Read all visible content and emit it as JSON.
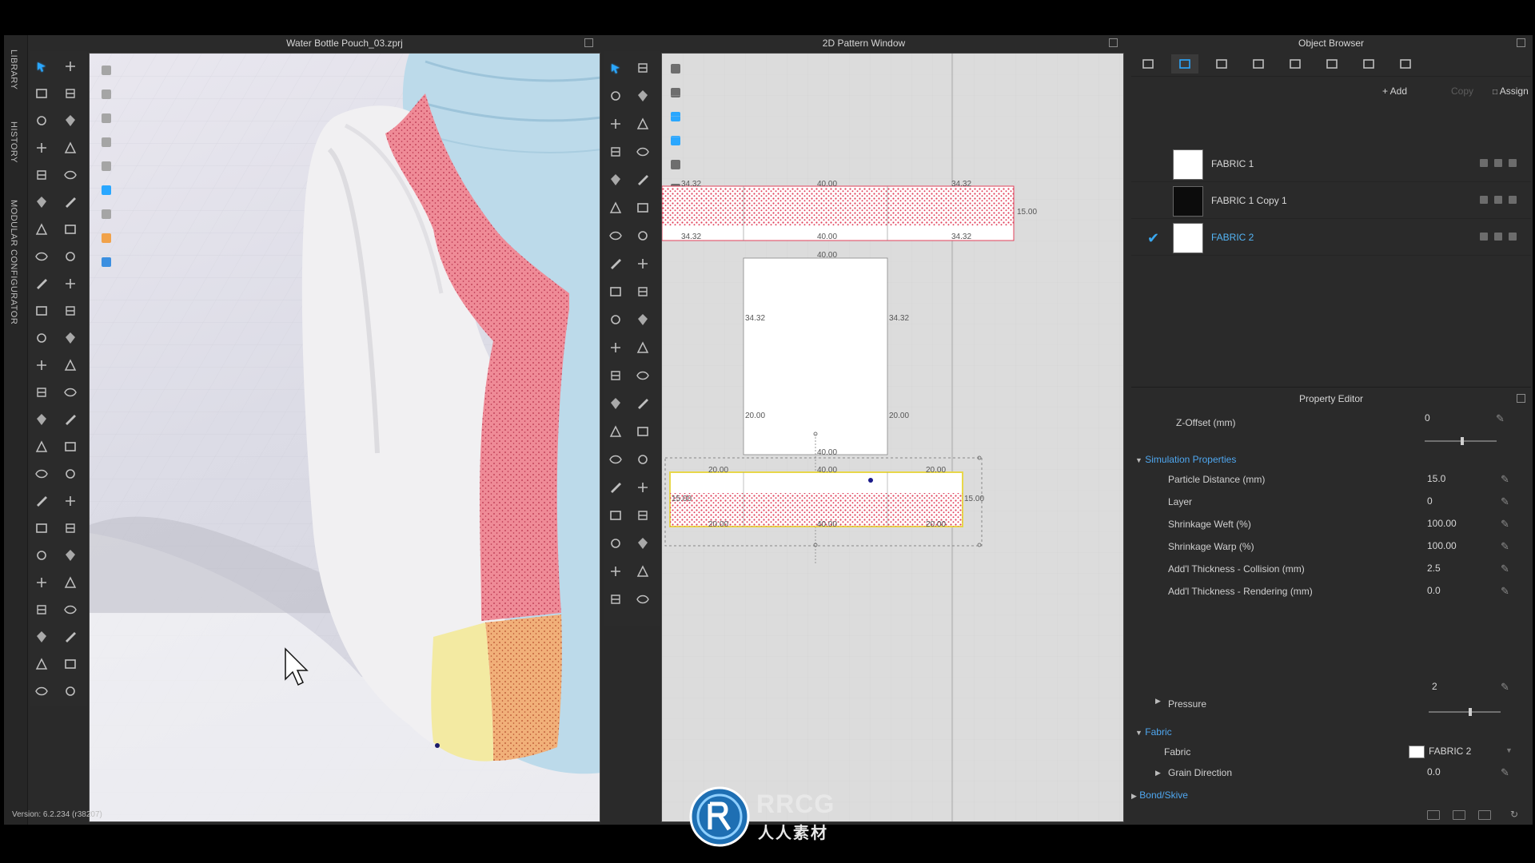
{
  "left_tabs": [
    "LIBRARY",
    "HISTORY",
    "MODULAR CONFIGURATOR"
  ],
  "window_3d": {
    "title": "Water Bottle Pouch_03.zprj"
  },
  "window_2d": {
    "title": "2D Pattern Window",
    "labels": {
      "top_strip_upper": [
        "34.32",
        "40.00",
        "34.32"
      ],
      "top_strip_lower": [
        "34.32",
        "40.00",
        "34.32"
      ],
      "top_strip_side": "15.00",
      "rect_top": "40.00",
      "rect_left_upper": "34.32",
      "rect_right_upper": "34.32",
      "rect_left_lower": "20.00",
      "rect_right_lower": "20.00",
      "rect_bottom": "40.00",
      "bottom_strip_top": [
        "20.00",
        "40.00",
        "20.00"
      ],
      "bottom_strip_bottom": [
        "20.00",
        "40.00",
        "20.00"
      ],
      "bottom_strip_left": "15.00",
      "bottom_strip_right": "15.00"
    }
  },
  "object_browser": {
    "title": "Object Browser",
    "tabs": [
      "list-icon",
      "fabric-icon",
      "button-icon",
      "topstitch-icon",
      "trim-icon",
      "zipper-icon",
      "graphic-icon",
      "tape-icon"
    ],
    "actions": {
      "add": "+ Add",
      "copy": "Copy",
      "assign": "Assign"
    },
    "fabrics": [
      {
        "name": "FABRIC 1",
        "swatch": "#ffffff",
        "selected": false
      },
      {
        "name": "FABRIC 1 Copy 1",
        "swatch": "#0c0c0c",
        "selected": false
      },
      {
        "name": "FABRIC 2",
        "swatch": "#ffffff",
        "selected": true
      }
    ]
  },
  "property_editor": {
    "title": "Property Editor",
    "z_offset": {
      "label": "Z-Offset (mm)",
      "value": "0",
      "slider": 0.5
    },
    "simulation_section": "Simulation Properties",
    "simulation": [
      {
        "label": "Particle Distance (mm)",
        "value": "15.0"
      },
      {
        "label": "Layer",
        "value": "0"
      },
      {
        "label": "Shrinkage Weft (%)",
        "value": "100.00"
      },
      {
        "label": "Shrinkage Warp (%)",
        "value": "100.00"
      },
      {
        "label": "Add'l Thickness - Collision (mm)",
        "value": "2.5"
      },
      {
        "label": "Add'l Thickness - Rendering (mm)",
        "value": "0.0"
      }
    ],
    "pressure": {
      "label": "Pressure",
      "value": "2",
      "slider": 0.55
    },
    "fabric_section": "Fabric",
    "fabric": {
      "label": "Fabric",
      "value": "FABRIC 2",
      "swatch": "#ffffff"
    },
    "grain": {
      "label": "Grain Direction",
      "value": "0.0"
    },
    "bond_section": "Bond/Skive"
  },
  "status": {
    "version": "Version: 6.2.234 (r38207)"
  },
  "watermark": {
    "brand": "RRCG",
    "sub": "人人素材"
  },
  "colors": {
    "accent": "#2aa7ff",
    "selected_text": "#54b5f6",
    "pattern_red": "#e1405a",
    "mesh_pink": "#ef8b97",
    "mesh_yellow": "#f3eaa2",
    "mesh_orange": "#f1b079",
    "bottle_blue": "#bcdaea"
  }
}
